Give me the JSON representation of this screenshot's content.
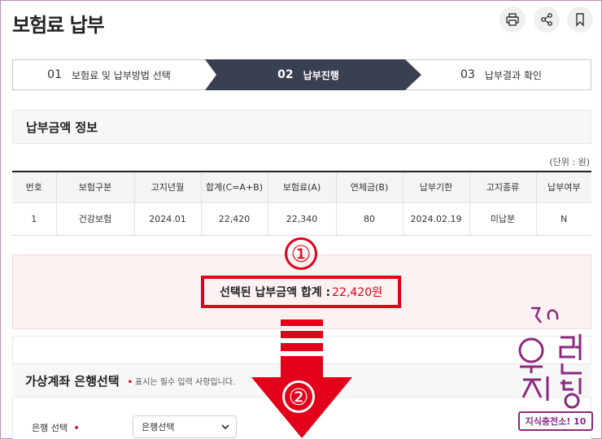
{
  "header": {
    "title": "보험료 납부",
    "icons": [
      "printer-icon",
      "share-icon",
      "bookmark-icon"
    ]
  },
  "steps": [
    {
      "num": "01",
      "label": "보험료 및 납부방법 선택",
      "active": false
    },
    {
      "num": "02",
      "label": "납부진행",
      "active": true
    },
    {
      "num": "03",
      "label": "납부결과 확인",
      "active": false
    }
  ],
  "section": {
    "title": "납부금액 정보",
    "unit": "(단위 : 원)"
  },
  "table": {
    "headers": [
      "번호",
      "보험구분",
      "고지년월",
      "합계(C=A+B)",
      "보험료(A)",
      "연체금(B)",
      "납부기한",
      "고지종류",
      "납부여부"
    ],
    "rows": [
      [
        "1",
        "건강보험",
        "2024.01",
        "22,420",
        "22,340",
        "80",
        "2024.02.19",
        "미납분",
        "N"
      ]
    ]
  },
  "total": {
    "label": "선택된 납부금액 합계 :",
    "amount": "22,420원"
  },
  "annotations": {
    "circle1": "①",
    "circle2": "②"
  },
  "bank": {
    "title": "가상계좌 은행선택",
    "required_note": "표시는 필수 입력 사항입니다.",
    "field_label": "은행 선택",
    "select_value": "은행선택"
  },
  "watermark": {
    "sign": "지식충전소! 10",
    "colors": {
      "purple": "#8a2a7e",
      "red": "#e3001b"
    }
  },
  "colors": {
    "active_step": "#3b3f52",
    "accent_red": "#e3001b",
    "total_bg": "#fdf2f2"
  }
}
